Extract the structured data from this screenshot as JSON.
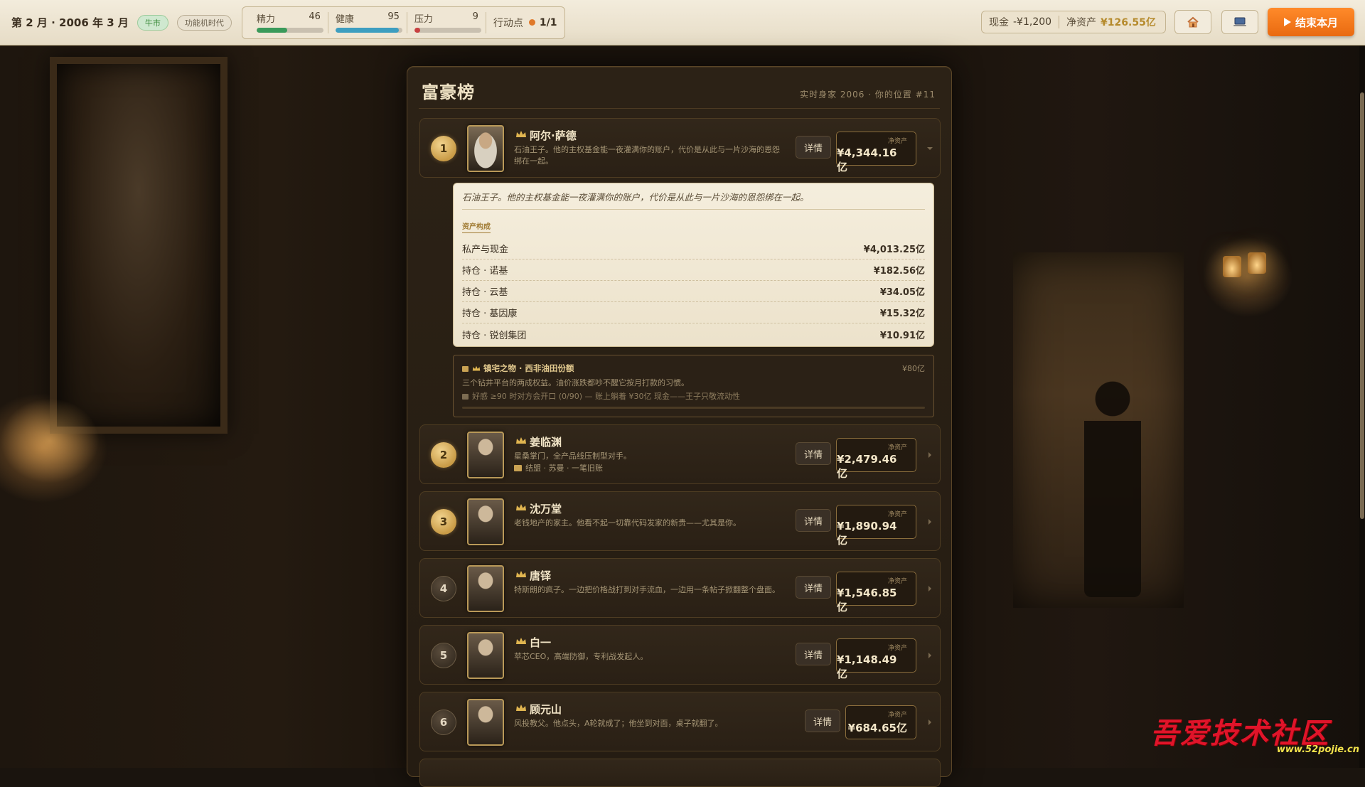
{
  "topbar": {
    "date": "第 2 月 · 2006 年 3 月",
    "market_tag": "牛市",
    "era_tag": "功能机时代",
    "stats": [
      {
        "label": "精力",
        "value": "46",
        "fill": 0.46,
        "color": "#3a9a5a"
      },
      {
        "label": "健康",
        "value": "95",
        "fill": 0.95,
        "color": "#3d9ec0"
      },
      {
        "label": "压力",
        "value": "9",
        "fill": 0.09,
        "color": "#c84040"
      }
    ],
    "action_points_label": "行动点",
    "action_points_value": "1/1",
    "cash_label": "现金",
    "cash_value": "-¥1,200",
    "net_label": "净资产",
    "net_value": "¥126.55亿",
    "home_icon": "home-icon",
    "computer_icon": "computer-icon",
    "end_month_label": "结束本月"
  },
  "panel": {
    "title": "富豪榜",
    "subtitle": "实时身家 2006 · 你的位置 #11"
  },
  "ranking": [
    {
      "rank": "1",
      "name": "阿尔·萨德",
      "desc": "石油王子。他的主权基金能一夜灌满你的账户，代价是从此与一片沙海的恩怨绑在一起。",
      "alliance": "",
      "detail_label": "详情",
      "nw_label": "净资产",
      "nw_value": "¥4,344.16亿",
      "expanded": true
    },
    {
      "rank": "2",
      "name": "姜临渊",
      "desc": "星桑掌门，全产品线压制型对手。",
      "alliance": "结盟 · 苏曼 · 一笔旧账",
      "detail_label": "详情",
      "nw_label": "净资产",
      "nw_value": "¥2,479.46亿",
      "expanded": false
    },
    {
      "rank": "3",
      "name": "沈万堂",
      "desc": "老钱地产的家主。他看不起一切靠代码发家的新贵——尤其是你。",
      "alliance": "",
      "detail_label": "详情",
      "nw_label": "净资产",
      "nw_value": "¥1,890.94亿",
      "expanded": false
    },
    {
      "rank": "4",
      "name": "唐铎",
      "desc": "特斯朗的疯子。一边把价格战打到对手流血，一边用一条帖子掀翻整个盘面。",
      "alliance": "",
      "detail_label": "详情",
      "nw_label": "净资产",
      "nw_value": "¥1,546.85亿",
      "expanded": false
    },
    {
      "rank": "5",
      "name": "白一",
      "desc": "苹芯CEO，高端防御，专利战发起人。",
      "alliance": "",
      "detail_label": "详情",
      "nw_label": "净资产",
      "nw_value": "¥1,148.49亿",
      "expanded": false
    },
    {
      "rank": "6",
      "name": "顾元山",
      "desc": "风投教父。他点头，A轮就成了；他坐到对面，桌子就翻了。",
      "alliance": "",
      "detail_label": "详情",
      "nw_label": "净资产",
      "nw_value": "¥684.65亿",
      "expanded": false
    }
  ],
  "expanded_detail": {
    "quote": "石油王子。他的主权基金能一夜灌满你的账户，代价是从此与一片沙海的恩怨绑在一起。",
    "assets_title": "资产构成",
    "assets": [
      {
        "label": "私产与现金",
        "value": "¥4,013.25亿"
      },
      {
        "label": "持仓 · 诺基",
        "value": "¥182.56亿"
      },
      {
        "label": "持仓 · 云基",
        "value": "¥34.05亿"
      },
      {
        "label": "持仓 · 基因康",
        "value": "¥15.32亿"
      },
      {
        "label": "持仓 · 锐创集团",
        "value": "¥10.91亿"
      }
    ],
    "heirloom": {
      "title": "镇宅之物 · 西非油田份额",
      "value": "¥80亿",
      "desc": "三个钻井平台的两成权益。油价涨跌都吵不醒它按月打款的习惯。",
      "condition": "好感 ≥90 时对方会开口 (0/90) — 账上躺着 ¥30亿 现金——王子只敬流动性",
      "progress": 0
    }
  },
  "watermark": {
    "text": "吾爱技术社区",
    "url": "www.52pojie.cn"
  }
}
